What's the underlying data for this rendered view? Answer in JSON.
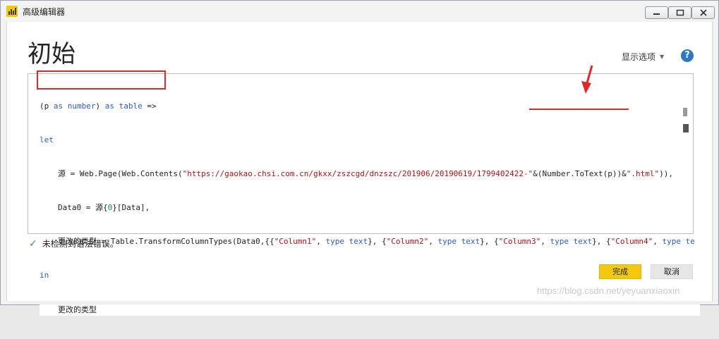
{
  "window": {
    "title": "高级编辑器"
  },
  "header": {
    "page_title": "初始",
    "display_options_label": "显示选项",
    "help_label": "?"
  },
  "editor": {
    "line1": {
      "open": "(p ",
      "kw1": "as",
      "t1": " ",
      "type1": "number",
      "close": ") ",
      "kw2": "as",
      "t2": " ",
      "type2": "table",
      "arrow": " =>"
    },
    "line2": "let",
    "line3": {
      "prefix": "源 = Web.Page(Web.Contents(",
      "url": "\"https://gaokao.chsi.com.cn/gkxx/zszcgd/dnzszc/201906/20190619/1799402422-\"",
      "mid": "&(Number.ToText(p))&",
      "ext": "\".html\"",
      "suffix": ")),"
    },
    "line4": {
      "prefix": "Data0 = 源{",
      "index": "0",
      "suffix": "}[Data],"
    },
    "line5": {
      "prefix": "更改的类型 = Table.TransformColumnTypes(Data0,{{",
      "c1": "\"Column1\"",
      "s1": ", ",
      "ty1": "type",
      "sp1": " ",
      "tx1": "text",
      "e1": "}, {",
      "c2": "\"Column2\"",
      "s2": ", ",
      "ty2": "type",
      "sp2": " ",
      "tx2": "text",
      "e2": "}, {",
      "c3": "\"Column3\"",
      "s3": ", ",
      "ty3": "type",
      "sp3": " ",
      "tx3": "text",
      "e3": "}, {",
      "c4": "\"Column4\"",
      "s4": ", ",
      "ty4": "type",
      "sp4": " ",
      "tx4": "te"
    },
    "line6": "in",
    "line7": "更改的类型"
  },
  "status": {
    "message": "未检测到语法错误。"
  },
  "footer": {
    "ok_label": "完成",
    "cancel_label": "取消"
  },
  "watermark": "https://blog.csdn.net/yeyuanxiaoxin",
  "colors": {
    "accent": "#f2c811",
    "annotation": "#e0282a",
    "keyword": "#2f5bb7",
    "string": "#a31515"
  }
}
